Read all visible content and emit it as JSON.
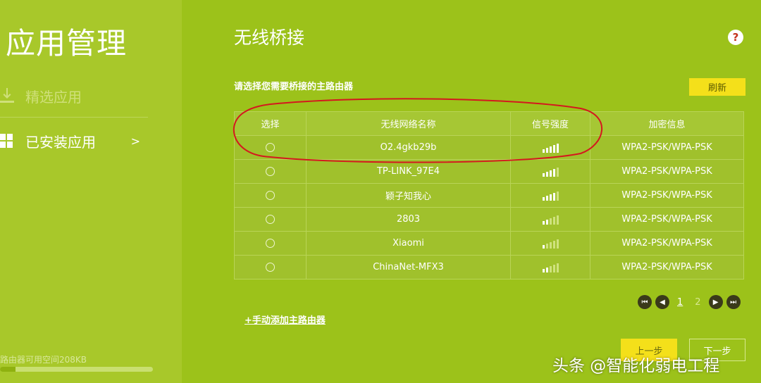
{
  "sidebar": {
    "title": "应用管理",
    "items": [
      {
        "label": "精选应用",
        "icon": "download-icon"
      },
      {
        "label": "已安装应用",
        "icon": "grid-icon",
        "chevron": ">"
      }
    ],
    "storage_text": "路由器可用空间208KB",
    "storage_fill_fraction": 0.1
  },
  "main": {
    "title": "无线桥接",
    "help_icon": "?",
    "subtitle": "请选择您需要桥接的主路由器",
    "refresh_label": "刷新",
    "table": {
      "headers": [
        "选择",
        "无线网络名称",
        "信号强度",
        "加密信息"
      ],
      "rows": [
        {
          "ssid": "O2.4gkb29b",
          "signal": 5,
          "encryption": "WPA2-PSK/WPA-PSK"
        },
        {
          "ssid": "TP-LINK_97E4",
          "signal": 4,
          "encryption": "WPA2-PSK/WPA-PSK"
        },
        {
          "ssid": "颖子知我心",
          "signal": 4,
          "encryption": "WPA2-PSK/WPA-PSK"
        },
        {
          "ssid": "2803",
          "signal": 2,
          "encryption": "WPA2-PSK/WPA-PSK"
        },
        {
          "ssid": "Xiaomi",
          "signal": 1,
          "encryption": "WPA2-PSK/WPA-PSK"
        },
        {
          "ssid": "ChinaNet-MFX3",
          "signal": 2,
          "encryption": "WPA2-PSK/WPA-PSK"
        }
      ]
    },
    "pager": {
      "pages": [
        "1",
        "2"
      ],
      "current": "1"
    },
    "manual_add_label": "+手动添加主路由器",
    "prev_label": "上一步",
    "next_label": "下一步"
  },
  "watermark": "头条 @智能化弱电工程",
  "colors": {
    "background": "#9cc21a",
    "accent_button": "#f4e01a",
    "annotation": "#d4181e"
  }
}
